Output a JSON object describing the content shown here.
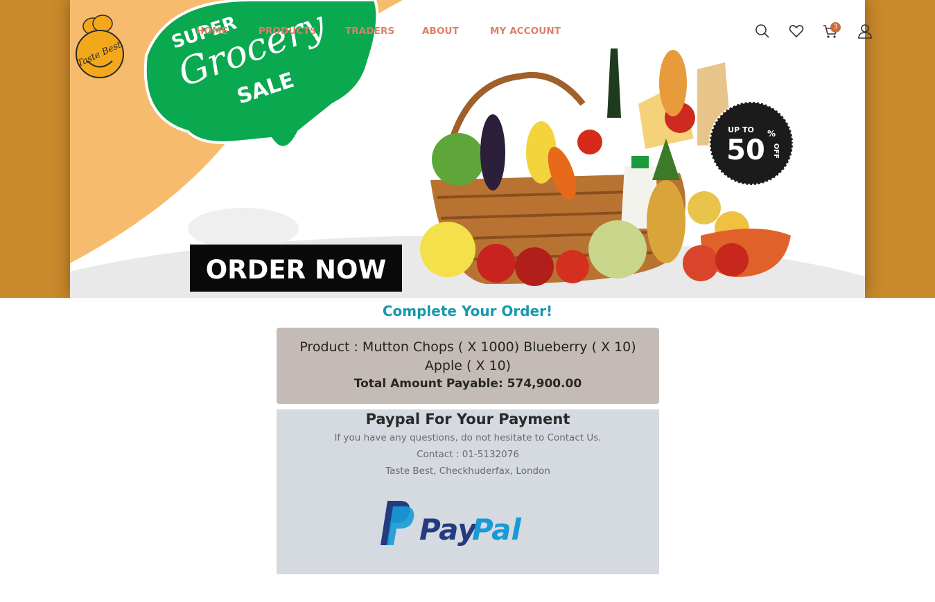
{
  "banner": {
    "ribbon_line1": "SUPER",
    "ribbon_line2": "Grocery",
    "ribbon_line3": "SALE",
    "badge_top": "UP TO",
    "badge_value": "50",
    "badge_pct": "%",
    "badge_off": "OFF",
    "order_button": "ORDER NOW"
  },
  "logo": {
    "text": "Taste Best"
  },
  "nav": {
    "home": "HOME",
    "products": "PRODUCTS",
    "traders": "TRADERS",
    "about": "ABOUT",
    "account": "MY ACCOUNT"
  },
  "header_icons": [
    "search-icon",
    "heart-icon",
    "cart-icon",
    "user-icon"
  ],
  "cart": {
    "count": "3"
  },
  "order": {
    "title": "Complete Your Order!",
    "products": "Product : Mutton Chops ( X 1000) Blueberry ( X 10) Apple ( X 10)",
    "total": "Total Amount Payable: 574,900.00"
  },
  "payment": {
    "title": "Paypal For Your Payment",
    "help": "If you have any questions, do not hesitate to Contact Us.",
    "contact": "Contact : 01-5132076",
    "address": "Taste Best, Checkhuderfax, London",
    "logo_text_pay": "Pay",
    "logo_text_pal": "Pal"
  },
  "colors": {
    "accent": "#1798ad",
    "nav": "#dd7f68",
    "banner_bg": "#c98a2b",
    "ribbon": "#0aa84f",
    "summary_bg": "#c5bbb6",
    "payment_bg": "#d5d9e0",
    "paypal_dark": "#253b80",
    "paypal_light": "#179bd7"
  }
}
